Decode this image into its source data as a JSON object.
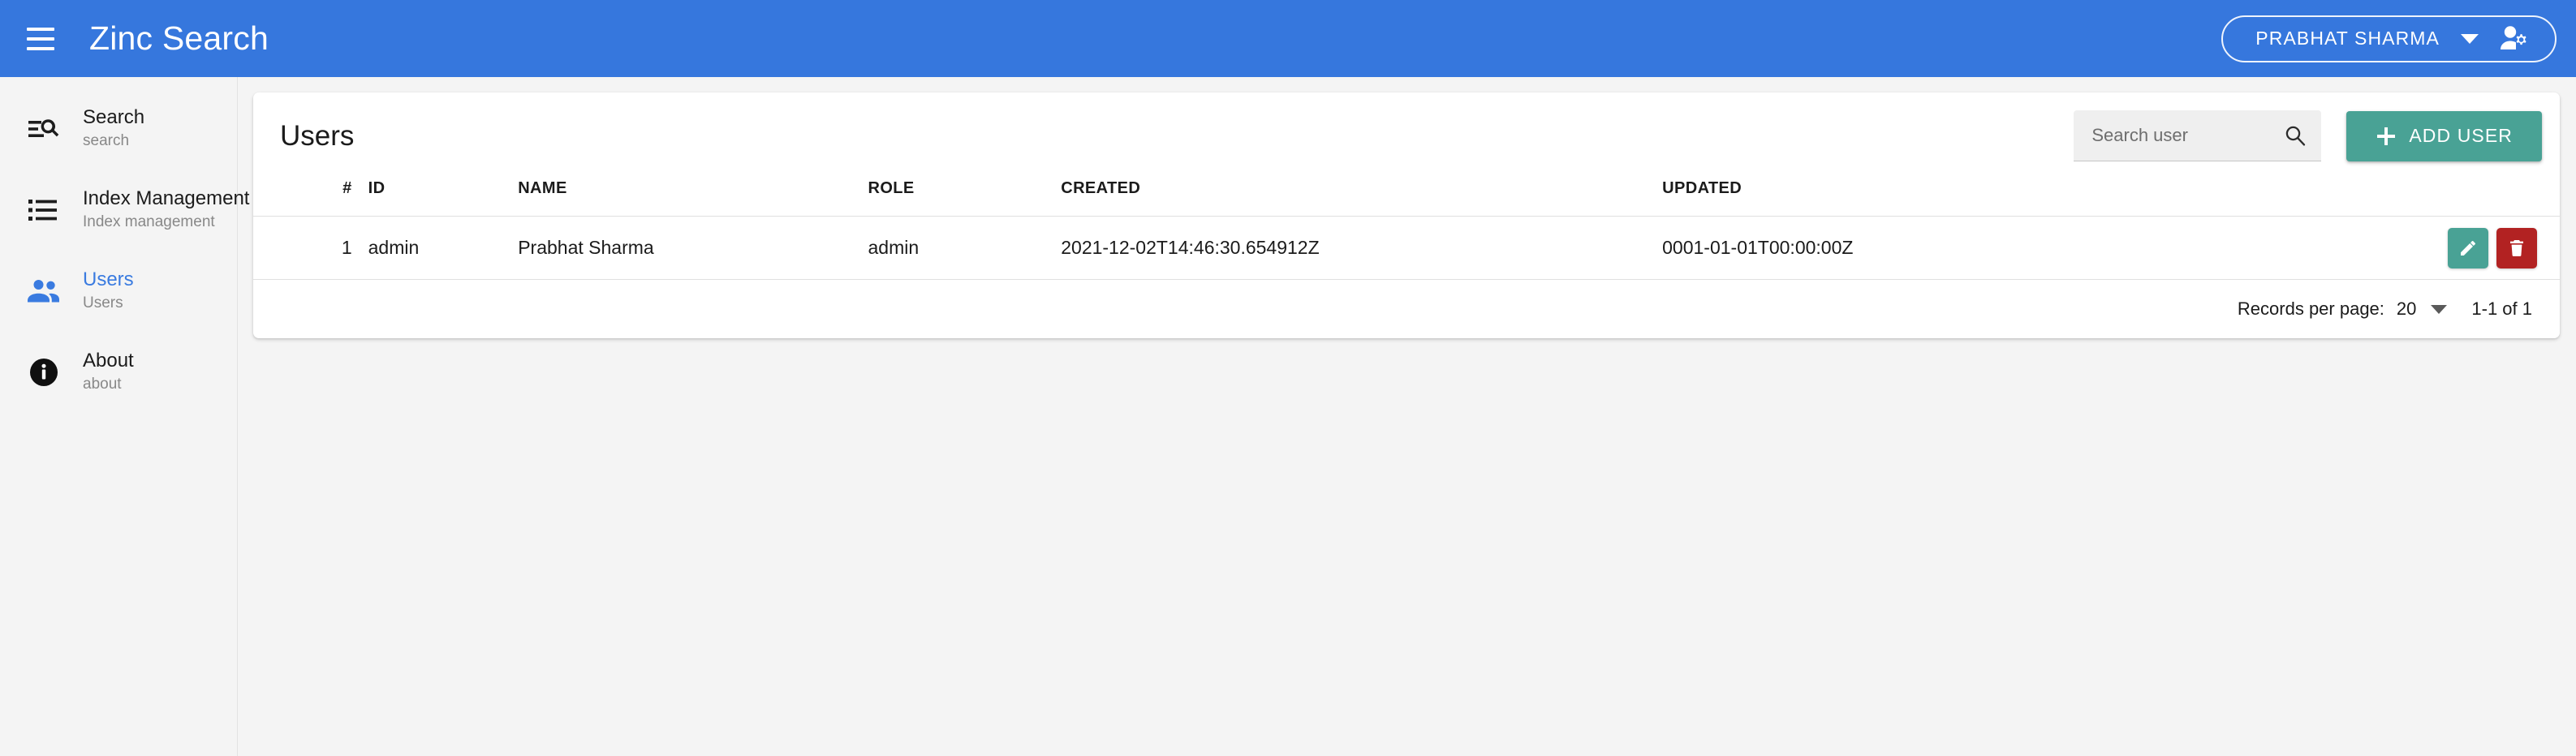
{
  "topbar": {
    "menu_icon": "hamburger-menu-icon",
    "brand": "Zinc Search",
    "user_menu": {
      "name": "PRABHAT SHARMA",
      "caret_icon": "chevron-down-icon",
      "avatar_icon": "user-settings-icon"
    },
    "background_color": "#3677DD"
  },
  "sidebar": {
    "background_color": "#F4F4F4",
    "active_color": "#3A7BE0",
    "items": [
      {
        "title": "Search",
        "caption": "search",
        "icon": "search-list-icon",
        "active": false
      },
      {
        "title": "Index Management",
        "caption": "Index management",
        "icon": "list-icon",
        "active": false
      },
      {
        "title": "Users",
        "caption": "Users",
        "icon": "people-icon",
        "active": true
      },
      {
        "title": "About",
        "caption": "about",
        "icon": "info-circle-icon",
        "active": false
      }
    ]
  },
  "main": {
    "card_title": "Users",
    "search": {
      "placeholder": "Search user",
      "value": "",
      "icon": "search-icon"
    },
    "add_user_button": {
      "label": "ADD USER",
      "icon": "plus-icon",
      "color": "#49A295"
    },
    "table": {
      "columns": [
        "#",
        "ID",
        "NAME",
        "ROLE",
        "CREATED",
        "UPDATED",
        ""
      ],
      "rows": [
        {
          "num": "1",
          "id": "admin",
          "name": "Prabhat Sharma",
          "role": "admin",
          "created": "2021-12-02T14:46:30.654912Z",
          "updated": "0001-01-01T00:00:00Z",
          "edit_icon": "pencil-icon",
          "delete_icon": "trash-icon"
        }
      ]
    },
    "footer": {
      "records_per_page_label": "Records per page:",
      "records_per_page_value": "20",
      "caret_icon": "chevron-down-icon",
      "range_label": "1-1 of 1"
    }
  }
}
